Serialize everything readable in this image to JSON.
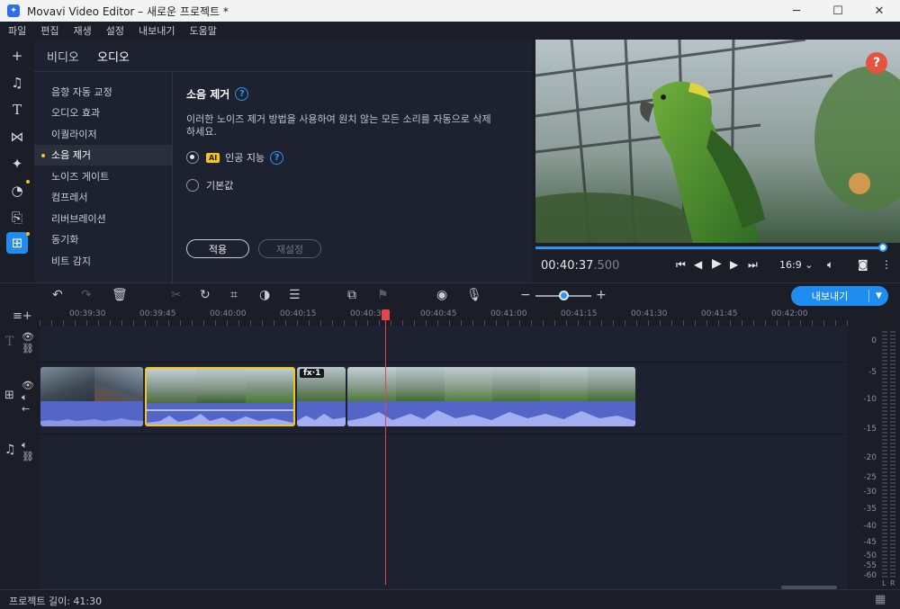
{
  "window": {
    "title": "Movavi Video Editor – 새로운 프로젝트 *",
    "minimize": "─",
    "maximize": "☐",
    "close": "✕"
  },
  "menu": [
    "파일",
    "편집",
    "재생",
    "설정",
    "내보내기",
    "도움말"
  ],
  "panel": {
    "tabs": [
      "비디오",
      "오디오"
    ],
    "active_tab": "오디오",
    "categories": [
      "음향 자동 교정",
      "오디오 효과",
      "이퀄라이저",
      "소음 제거",
      "노이즈 게이트",
      "컴프레서",
      "리버브레이션",
      "동기화",
      "비트 감지"
    ],
    "active_category": "소음 제거",
    "detail": {
      "title": "소음 제거",
      "description": "이러한 노이즈 제거 방법을 사용하여 원치 않는 모든 소리를 자동으로 삭제하세요.",
      "option_ai_badge": "AI",
      "option_ai_label": "인공 지능",
      "option_default_label": "기본값",
      "apply": "적용",
      "reset": "재설정"
    }
  },
  "player": {
    "timecode_main": "00:40:37",
    "timecode_ms": ".500",
    "progress": 0.99,
    "aspect": "16:9 ⌄"
  },
  "toolbar": {
    "export_label": "내보내기"
  },
  "ruler": [
    "00:39:30",
    "00:39:45",
    "00:40:00",
    "00:40:15",
    "00:40:30",
    "00:40:45",
    "00:41:00",
    "00:41:15",
    "00:41:30",
    "00:41:45",
    "00:42:00"
  ],
  "clips": {
    "fx_label": "fx·1"
  },
  "meter": {
    "db_labels": [
      "0",
      "-5",
      "-10",
      "-15",
      "-20",
      "-25",
      "-30",
      "-35",
      "-40",
      "-45",
      "-50",
      "-55",
      "-60"
    ],
    "left": "L",
    "right": "R"
  },
  "status": {
    "project_length": "프로젝트 길이: 41:30"
  },
  "colors": {
    "accent": "#1e8cf0",
    "selection": "#f5c518",
    "playhead": "#e2474b",
    "audio_wave": "#5465c8"
  }
}
